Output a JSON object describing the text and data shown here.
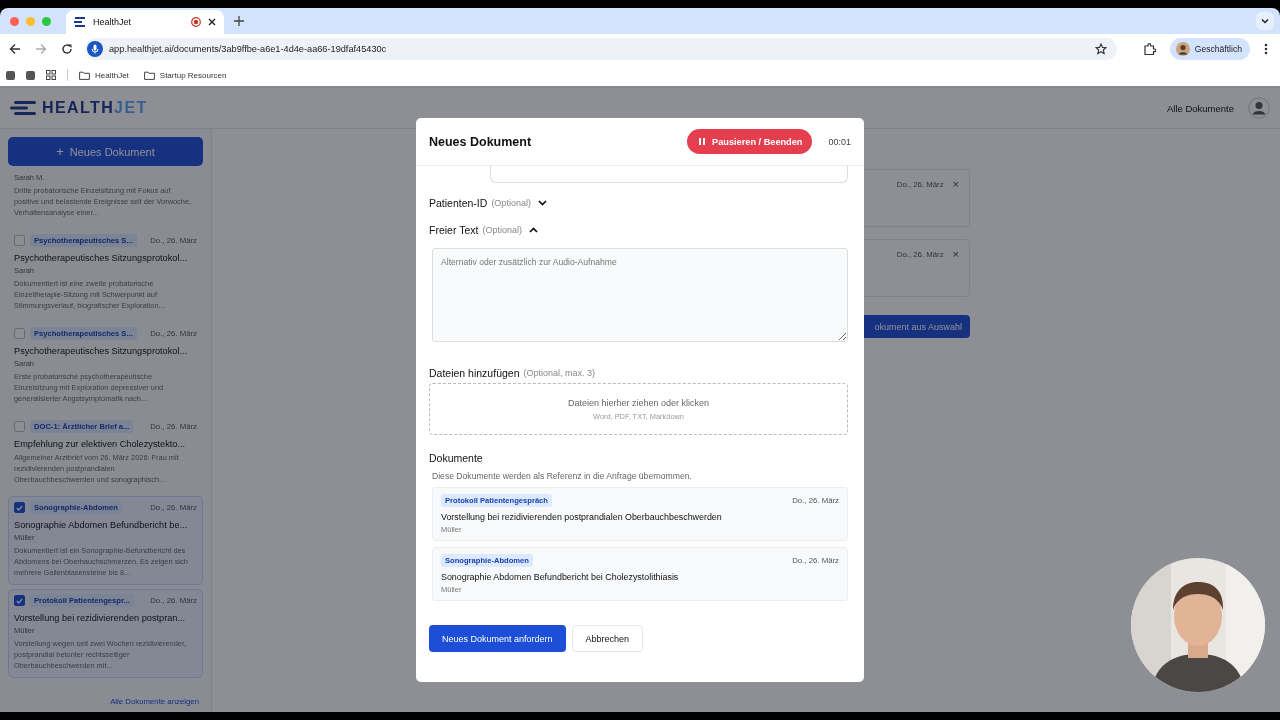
{
  "browser": {
    "tab": {
      "title": "HealthJet"
    },
    "url": "app.healthjet.ai/documents/3ab9ffbe-a6e1-4d4e-aa66-19dfaf45430c",
    "profile": "Geschäftlich",
    "bookmarks": [
      "HealthJet",
      "Startup Resourcen"
    ]
  },
  "header": {
    "logo": [
      "HEALTH",
      "JET"
    ],
    "nav_link": "Alle Dokumente"
  },
  "sidebar": {
    "new_button": {
      "icon": "+",
      "label": "Neues Dokument"
    },
    "items": [
      {
        "author": "Sarah M.",
        "summary": "Dritte probatorische Einzelsitzung mit Fokus auf positive und belastende Ereignisse seit der Vorwoche, Verhaltensanalyse einer..."
      },
      {
        "checked": false,
        "tag": "Psychotherapeutisches S...",
        "date": "Do., 26. März",
        "title": "Psychotherapeutisches Sitzungsprotokol...",
        "author": "Sarah",
        "summary": "Dokumentiert ist eine zweite probatorische Einzeltherapie-Sitzung mit Schwerpunkt auf Stimmungsverlauf, biografischer Exploration..."
      },
      {
        "checked": false,
        "tag": "Psychotherapeutisches S...",
        "date": "Do., 26. März",
        "title": "Psychotherapeutisches Sitzungsprotokol...",
        "author": "Sarah",
        "summary": "Erste probatorische psychotherapeutische Einzelsitzung mit Exploration depressiver und generalisierter Angstsymptomatik nach..."
      },
      {
        "checked": false,
        "tag": "DOC-1: Ärztlicher Brief a...",
        "date": "Do., 26. März",
        "title": "Empfehlung zur elektiven Cholezystekto...",
        "summary": "Allgemeiner Arztbrief vom 26. März 2026: Frau mit rezidivierenden postprandialen Oberbauchbeschwerden und sonographisch..."
      },
      {
        "checked": true,
        "tag": "Sonographie-Abdomen",
        "date": "Do., 26. März",
        "title": "Sonographie Abdomen Befundbericht be...",
        "author": "Müller",
        "summary": "Dokumentiert ist ein Sonographie-Befundbericht des Abdomens bei Oberbauchschmerzen. Es zeigen sich mehrere Gallenblasensteine bis 8..."
      },
      {
        "checked": true,
        "tag": "Protokoll Patientengespr...",
        "date": "Do., 26. März",
        "title": "Vorstellung bei rezidivierenden postpran...",
        "author": "Müller",
        "summary": "Vorstellung wegen seit zwei Wochen rezidivierender, postprandial betonter rechtsseitiger Oberbauchbeschwerden mit..."
      }
    ],
    "show_all": "Alle Dokumente anzeigen"
  },
  "background": {
    "cards": [
      {
        "date": "Do., 26. März",
        "close": "×"
      },
      {
        "date": "Do., 26. März",
        "close": "×"
      }
    ],
    "action_button": "okument aus Auswahl"
  },
  "modal": {
    "title": "Neues Dokument",
    "record_button": "Pausieren / Beenden",
    "timer": "00:01",
    "sections": [
      {
        "kind": "collapsible",
        "label": "Patienten-ID",
        "hint": "(Optional)",
        "expanded": false
      },
      {
        "kind": "collapsible",
        "label": "Freier Text",
        "hint": "(Optional)",
        "expanded": true,
        "placeholder": "Alternativ oder zusätzlich zur Audio-Aufnahme"
      }
    ],
    "upload": {
      "label": "Dateien hinzufügen",
      "hint": "(Optional, max. 3)",
      "text": "Dateien hierher ziehen oder klicken",
      "formats": "Word, PDF, TXT, Markdown"
    },
    "documents": {
      "heading": "Dokumente",
      "description": "Diese Dokumente werden als Referenz in die Anfrage übernommen.",
      "items": [
        {
          "tag": "Protokoll Patientengespräch",
          "date": "Do., 26. März",
          "title": "Vorstellung bei rezidivierenden postprandialen Oberbauchbeschwerden",
          "author": "Müller"
        },
        {
          "tag": "Sonographie-Abdomen",
          "date": "Do., 26. März",
          "title": "Sonographie Abdomen Befundbericht bei Cholezystolithiasis",
          "author": "Müller"
        }
      ]
    },
    "buttons": [
      {
        "label": "Neues Dokument anfordern",
        "kind": "primary"
      },
      {
        "label": "Abbrechen",
        "kind": "secondary"
      }
    ]
  }
}
